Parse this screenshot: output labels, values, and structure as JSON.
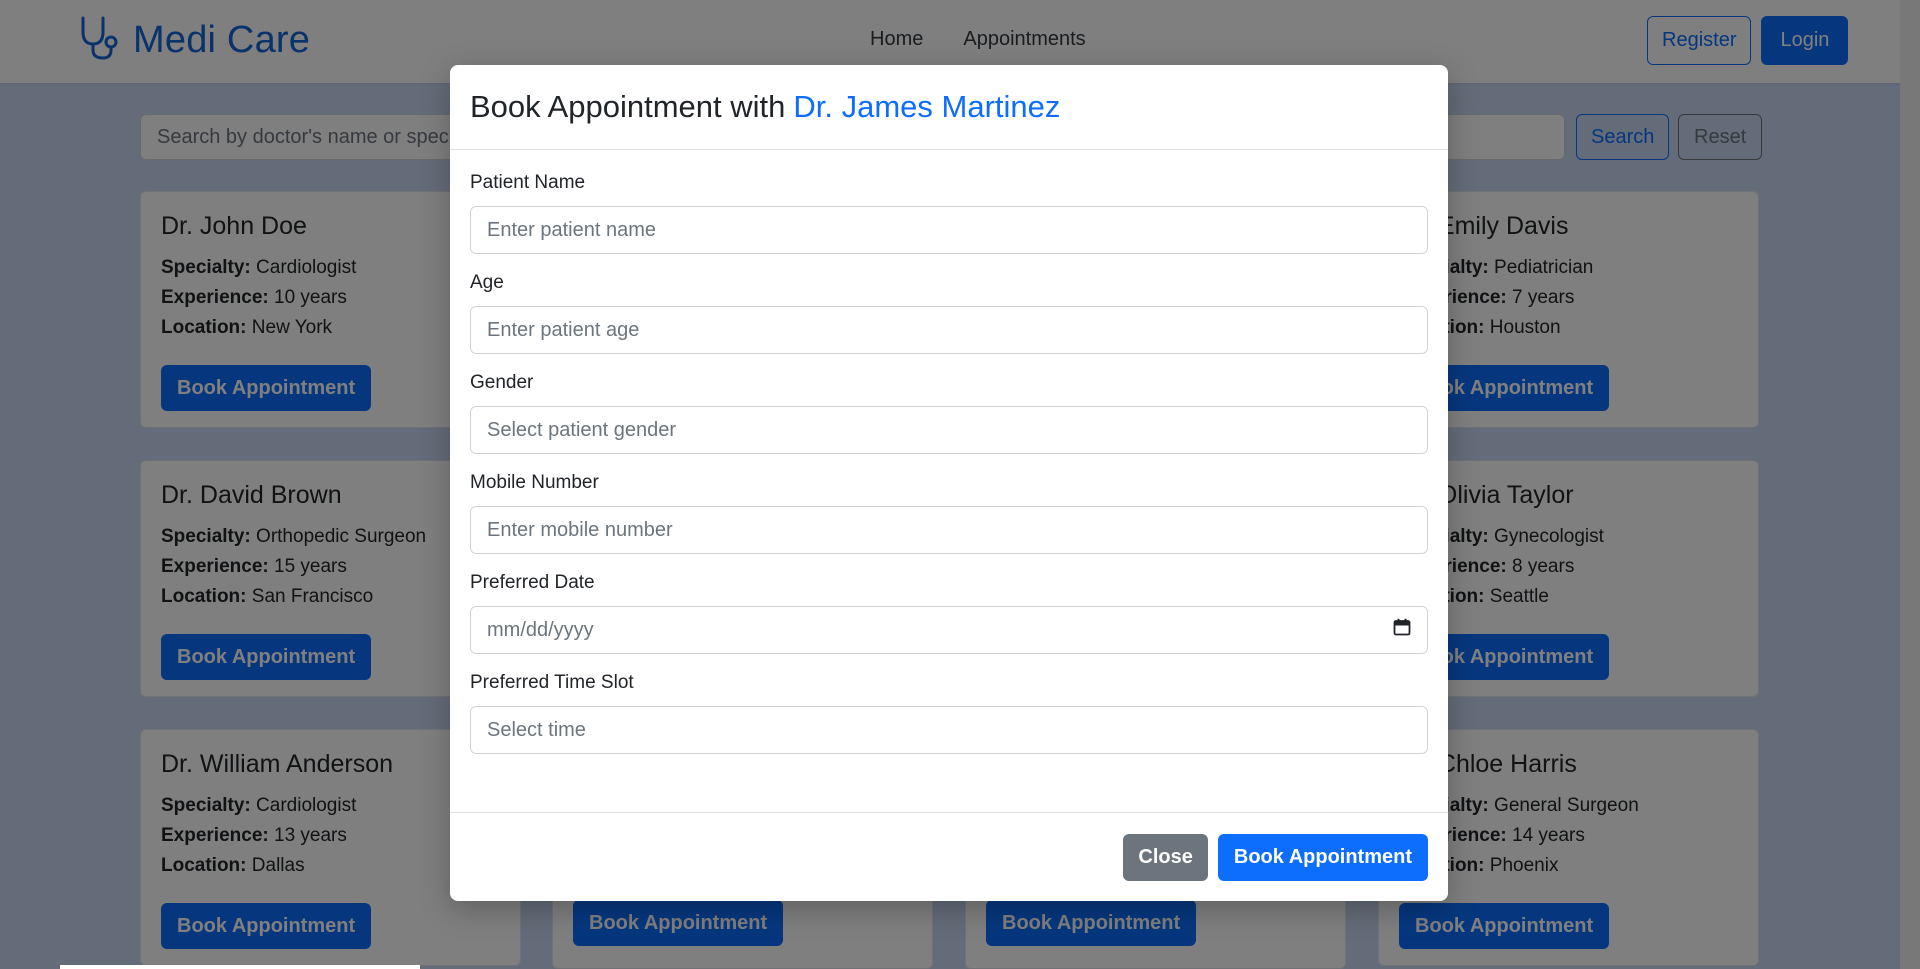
{
  "brand": {
    "name": "Medi Care",
    "icon": "stethoscope-icon",
    "color": "#1464d6"
  },
  "nav": {
    "links": [
      "Home",
      "Appointments"
    ],
    "register": "Register",
    "login": "Login"
  },
  "search": {
    "placeholder": "Search by doctor's name or specialty",
    "search_label": "Search",
    "reset_label": "Reset"
  },
  "labels": {
    "specialty": "Specialty:",
    "experience": "Experience:",
    "location": "Location:",
    "book": "Book Appointment"
  },
  "doctors": [
    {
      "name": "Dr. John Doe",
      "specialty": "Cardiologist",
      "experience": "10 years",
      "location": "New York"
    },
    {
      "name": "Dr. Emily Davis",
      "specialty": "Pediatrician",
      "experience": "7 years",
      "location": "Houston"
    },
    {
      "name": "Dr. David Brown",
      "specialty": "Orthopedic Surgeon",
      "experience": "15 years",
      "location": "San Francisco"
    },
    {
      "name": "Dr. Olivia Taylor",
      "specialty": "Gynecologist",
      "experience": "8 years",
      "location": "Seattle"
    },
    {
      "name": "Dr. William Anderson",
      "specialty": "Cardiologist",
      "experience": "13 years",
      "location": "Dallas"
    },
    {
      "name": "Dr. Chloe Harris",
      "specialty": "General Surgeon",
      "experience": "14 years",
      "location": "Phoenix"
    }
  ],
  "modal": {
    "title_prefix": "Book Appointment with",
    "doctor": "Dr. James Martinez",
    "fields": [
      {
        "label": "Patient Name",
        "placeholder": "Enter patient name"
      },
      {
        "label": "Age",
        "placeholder": "Enter patient age"
      },
      {
        "label": "Gender",
        "placeholder": "Select patient gender"
      },
      {
        "label": "Mobile Number",
        "placeholder": "Enter mobile number"
      },
      {
        "label": "Preferred Date",
        "placeholder": "mm/dd/yyyy",
        "icon": "calendar-icon"
      },
      {
        "label": "Preferred Time Slot",
        "placeholder": "Select time"
      }
    ],
    "close_label": "Close",
    "submit_label": "Book Appointment"
  },
  "colors": {
    "primary": "#0d6efd",
    "secondary": "#6c757d",
    "page_bg": "#c9d8f3"
  }
}
